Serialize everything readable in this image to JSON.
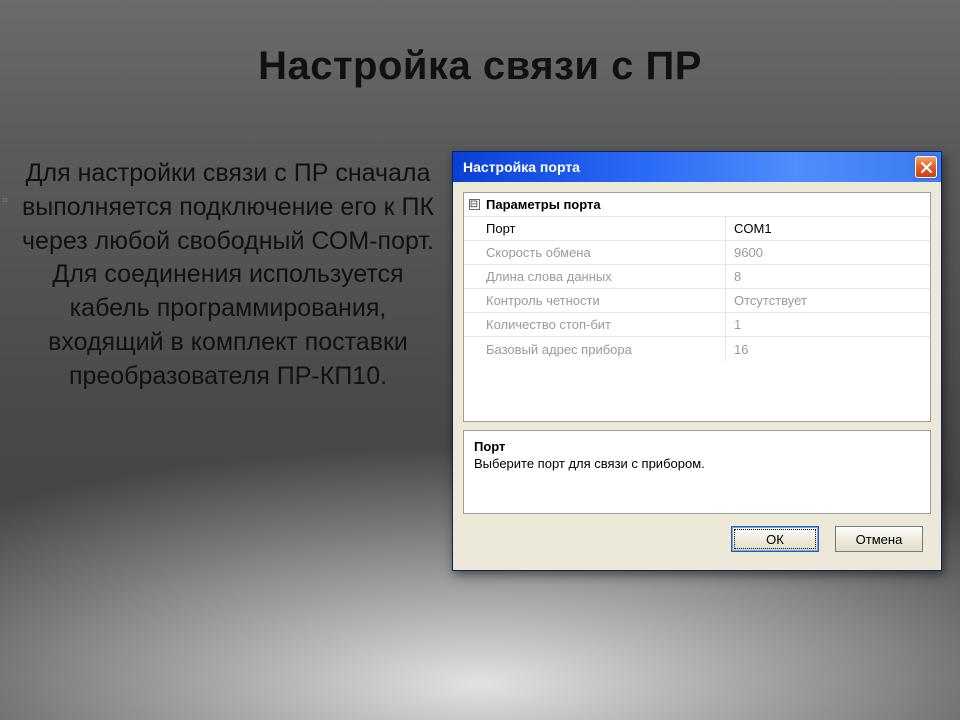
{
  "slide": {
    "title": "Настройка связи с ПР",
    "body": "Для настройки связи с ПР сначала выполняется подключение его к ПК через любой свободный СОМ-порт. Для соединения используется кабель программирования, входящий в комплект поставки преобразователя ПР-КП10."
  },
  "dialog": {
    "title": "Настройка порта",
    "group": "Параметры порта",
    "rows": [
      {
        "label": "Порт",
        "value": "COM1",
        "enabled": true
      },
      {
        "label": "Скорость обмена",
        "value": "9600",
        "enabled": false
      },
      {
        "label": "Длина слова данных",
        "value": "8",
        "enabled": false
      },
      {
        "label": "Контроль четности",
        "value": "Отсутствует",
        "enabled": false
      },
      {
        "label": "Количество стоп-бит",
        "value": "1",
        "enabled": false
      },
      {
        "label": "Базовый адрес прибора",
        "value": "16",
        "enabled": false
      }
    ],
    "help": {
      "title": "Порт",
      "text": "Выберите порт для связи с прибором."
    },
    "buttons": {
      "ok": "ОК",
      "cancel": "Отмена"
    },
    "toggle": "⊟"
  }
}
